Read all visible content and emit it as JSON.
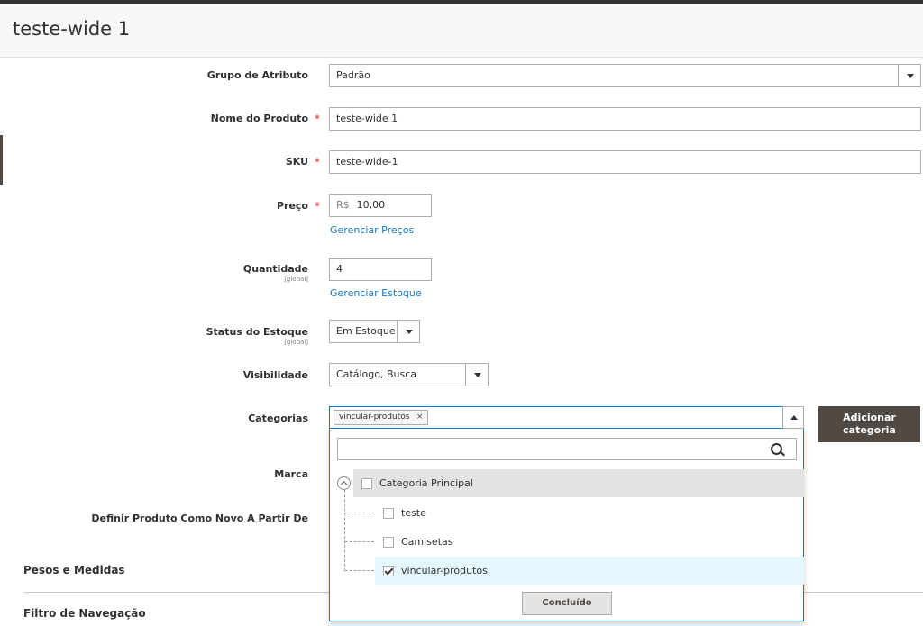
{
  "page": {
    "title": "teste-wide 1"
  },
  "form": {
    "attribute_set": {
      "label": "Grupo de Atributo",
      "value": "Padrão"
    },
    "product_name": {
      "label": "Nome do Produto",
      "required": "*",
      "value": "teste-wide 1"
    },
    "sku": {
      "label": "SKU",
      "required": "*",
      "value": "teste-wide-1"
    },
    "price": {
      "label": "Preço",
      "required": "*",
      "currency": "R$",
      "value": "10,00",
      "link": "Gerenciar Preços"
    },
    "quantity": {
      "label": "Quantidade",
      "scope": "[global]",
      "value": "4",
      "link": "Gerenciar Estoque"
    },
    "stock_status": {
      "label": "Status do Estoque",
      "scope": "[global]",
      "value": "Em Estoque"
    },
    "visibility": {
      "label": "Visibilidade",
      "value": "Catálogo, Busca"
    },
    "categories": {
      "label": "Categorias",
      "selected_tags": [
        "vincular-produtos"
      ],
      "tag_remove": "×",
      "add_button": "Adicionar categoria",
      "search_placeholder": "",
      "tree": {
        "root": "Categoria Principal",
        "children": [
          {
            "label": "teste",
            "checked": false
          },
          {
            "label": "Camisetas",
            "checked": false
          },
          {
            "label": "vincular-produtos",
            "checked": true
          }
        ]
      },
      "done_button": "Concluído"
    },
    "brand": {
      "label": "Marca"
    },
    "new_from": {
      "label": "Definir Produto Como Novo A Partir De"
    }
  },
  "sections": {
    "weights": "Pesos e Medidas",
    "navigation_filter": "Filtro de Navegação"
  },
  "colors": {
    "accent": "#007bdb",
    "link": "#1979c3",
    "required": "#e22626",
    "button_dark": "#514943",
    "selected_row": "#e5f7fe"
  }
}
